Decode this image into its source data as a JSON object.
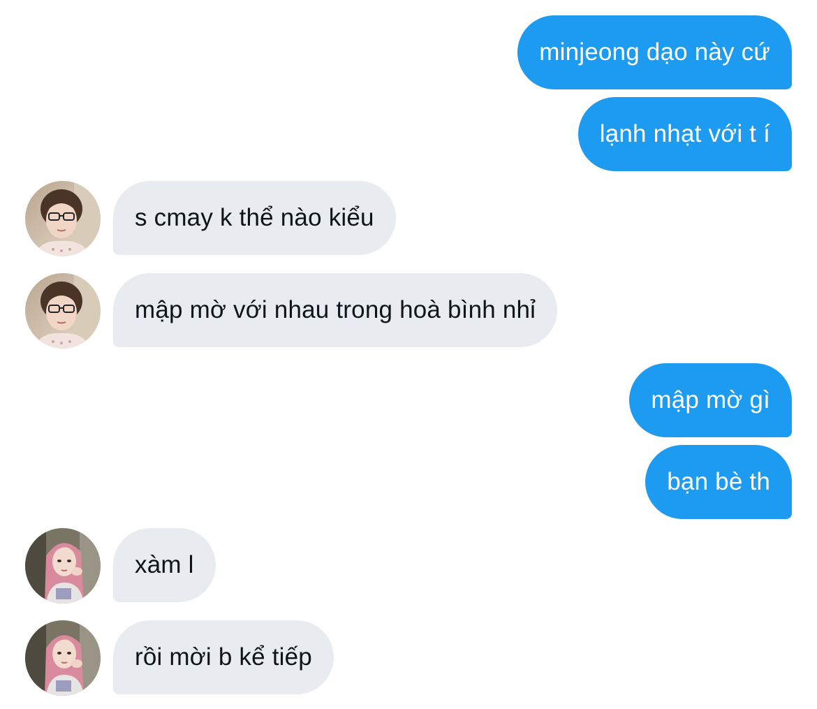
{
  "colors": {
    "outgoing_bubble": "#1d9bf0",
    "incoming_bubble": "#e8ecf0",
    "outgoing_text": "#ffffff",
    "incoming_text": "#0f1419"
  },
  "messages": [
    {
      "direction": "outgoing",
      "text": "minjeong dạo này cứ"
    },
    {
      "direction": "outgoing",
      "text": "lạnh nhạt với t í"
    },
    {
      "direction": "incoming",
      "avatar": "user-avatar-glasses",
      "text": "s cmay k thể nào kiểu"
    },
    {
      "direction": "incoming",
      "avatar": "user-avatar-glasses",
      "text": "mập mờ với nhau trong hoà bình nhỉ"
    },
    {
      "direction": "outgoing",
      "text": "mập mờ gì"
    },
    {
      "direction": "outgoing",
      "text": "bạn bè th"
    },
    {
      "direction": "incoming",
      "avatar": "user-avatar-pink-hair",
      "text": "xàm l"
    },
    {
      "direction": "incoming",
      "avatar": "user-avatar-pink-hair",
      "text": "rồi mời b kể tiếp"
    }
  ]
}
